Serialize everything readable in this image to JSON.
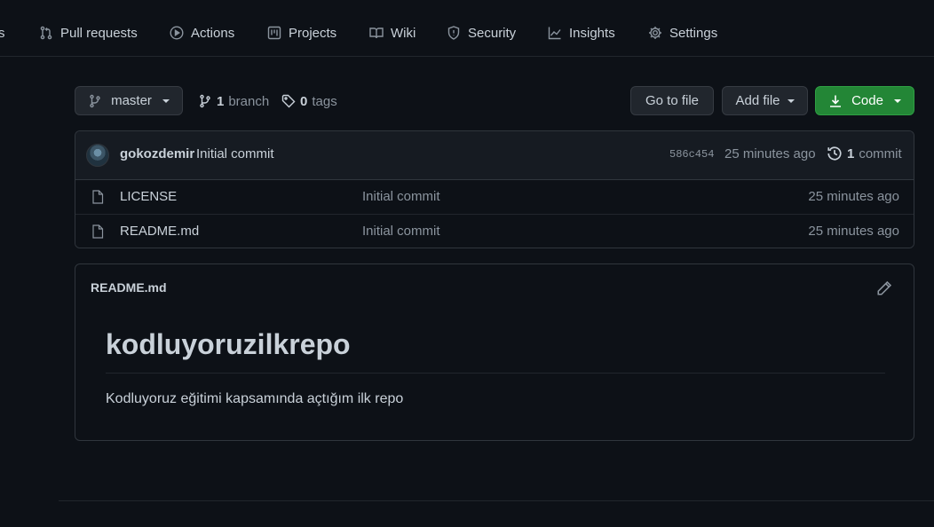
{
  "nav": {
    "items": [
      {
        "label": "s"
      },
      {
        "label": "Pull requests"
      },
      {
        "label": "Actions"
      },
      {
        "label": "Projects"
      },
      {
        "label": "Wiki"
      },
      {
        "label": "Security"
      },
      {
        "label": "Insights"
      },
      {
        "label": "Settings"
      }
    ]
  },
  "branch_bar": {
    "branch_name": "master",
    "branch_count": "1",
    "branch_word": "branch",
    "tag_count": "0",
    "tag_word": "tags",
    "go_to_file": "Go to file",
    "add_file": "Add file",
    "code": "Code"
  },
  "latest_commit": {
    "author": "gokozdemir",
    "message": "Initial commit",
    "sha": "586c454",
    "time": "25 minutes ago",
    "count": "1",
    "count_word": "commit"
  },
  "files": [
    {
      "name": "LICENSE",
      "commit": "Initial commit",
      "time": "25 minutes ago"
    },
    {
      "name": "README.md",
      "commit": "Initial commit",
      "time": "25 minutes ago"
    }
  ],
  "readme": {
    "filename": "README.md",
    "heading": "kodluyoruzilkrepo",
    "paragraph": "Kodluyoruz eğitimi kapsamında açtığım ilk repo"
  },
  "colors": {
    "background": "#0d1117",
    "border": "#30363d",
    "text": "#c9d1d9",
    "muted": "#8b949e",
    "code_button": "#238636"
  }
}
